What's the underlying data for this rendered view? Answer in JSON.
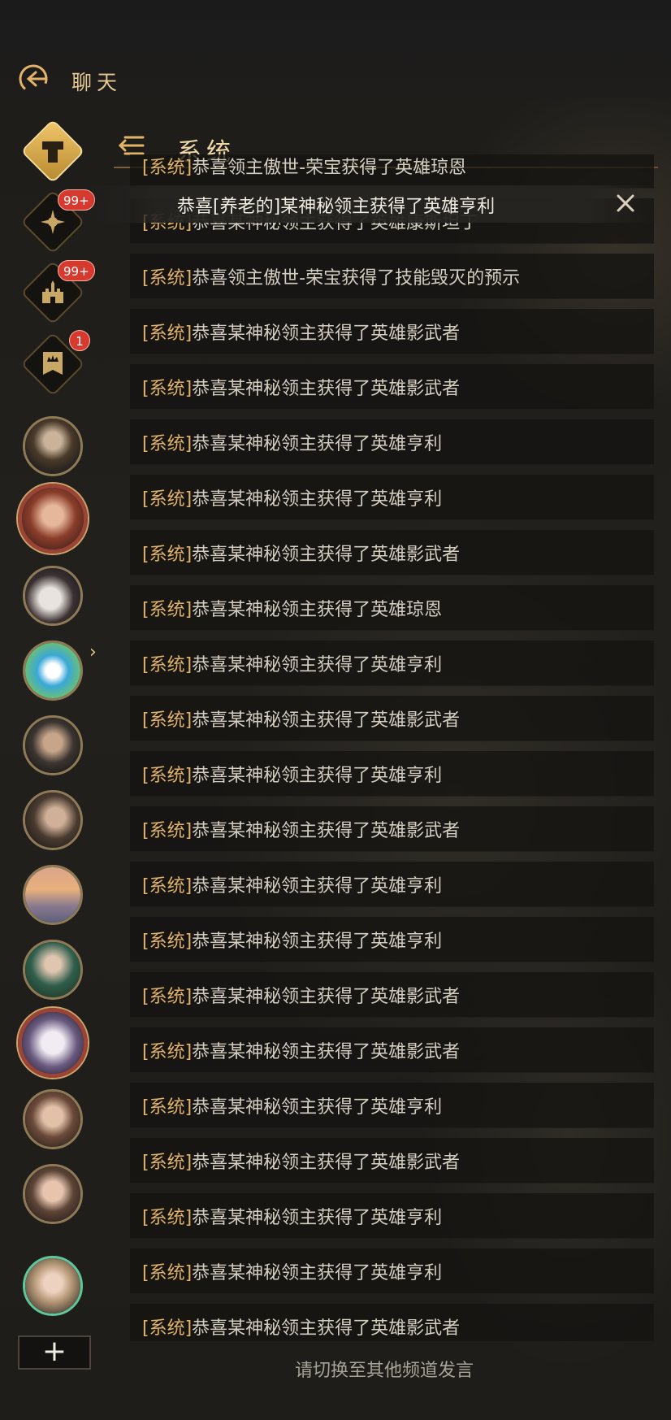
{
  "header": {
    "title": "聊天"
  },
  "channel": {
    "title": "系统"
  },
  "toast": {
    "text": "恭喜[养老的]某神秘领主获得了英雄亨利"
  },
  "rail": {
    "badges": [
      "99+",
      "99+",
      "1"
    ]
  },
  "messages": [
    {
      "tag": "[系统]",
      "text": "恭喜领主傲世-荣宝获得了英雄琼恩"
    },
    {
      "tag": "[系统]",
      "text": "恭喜某神秘领主获得了英雄康斯坦丁"
    },
    {
      "tag": "[系统]",
      "text": "恭喜领主傲世-荣宝获得了技能毁灭的预示"
    },
    {
      "tag": "[系统]",
      "text": "恭喜某神秘领主获得了英雄影武者"
    },
    {
      "tag": "[系统]",
      "text": "恭喜某神秘领主获得了英雄影武者"
    },
    {
      "tag": "[系统]",
      "text": "恭喜某神秘领主获得了英雄亨利"
    },
    {
      "tag": "[系统]",
      "text": "恭喜某神秘领主获得了英雄亨利"
    },
    {
      "tag": "[系统]",
      "text": "恭喜某神秘领主获得了英雄影武者"
    },
    {
      "tag": "[系统]",
      "text": "恭喜某神秘领主获得了英雄琼恩"
    },
    {
      "tag": "[系统]",
      "text": "恭喜某神秘领主获得了英雄亨利"
    },
    {
      "tag": "[系统]",
      "text": "恭喜某神秘领主获得了英雄影武者"
    },
    {
      "tag": "[系统]",
      "text": "恭喜某神秘领主获得了英雄亨利"
    },
    {
      "tag": "[系统]",
      "text": "恭喜某神秘领主获得了英雄影武者"
    },
    {
      "tag": "[系统]",
      "text": "恭喜某神秘领主获得了英雄亨利"
    },
    {
      "tag": "[系统]",
      "text": "恭喜某神秘领主获得了英雄亨利"
    },
    {
      "tag": "[系统]",
      "text": "恭喜某神秘领主获得了英雄影武者"
    },
    {
      "tag": "[系统]",
      "text": "恭喜某神秘领主获得了英雄影武者"
    },
    {
      "tag": "[系统]",
      "text": "恭喜某神秘领主获得了英雄亨利"
    },
    {
      "tag": "[系统]",
      "text": "恭喜某神秘领主获得了英雄影武者"
    },
    {
      "tag": "[系统]",
      "text": "恭喜某神秘领主获得了英雄亨利"
    },
    {
      "tag": "[系统]",
      "text": "恭喜某神秘领主获得了英雄亨利"
    },
    {
      "tag": "[系统]",
      "text": "恭喜某神秘领主获得了英雄影武者"
    }
  ],
  "footer": {
    "hint": "请切换至其他频道发言"
  },
  "add_button": {
    "label": "+"
  },
  "colors": {
    "accent_gold": "#e2b368",
    "badge_red": "#d63a2f"
  }
}
